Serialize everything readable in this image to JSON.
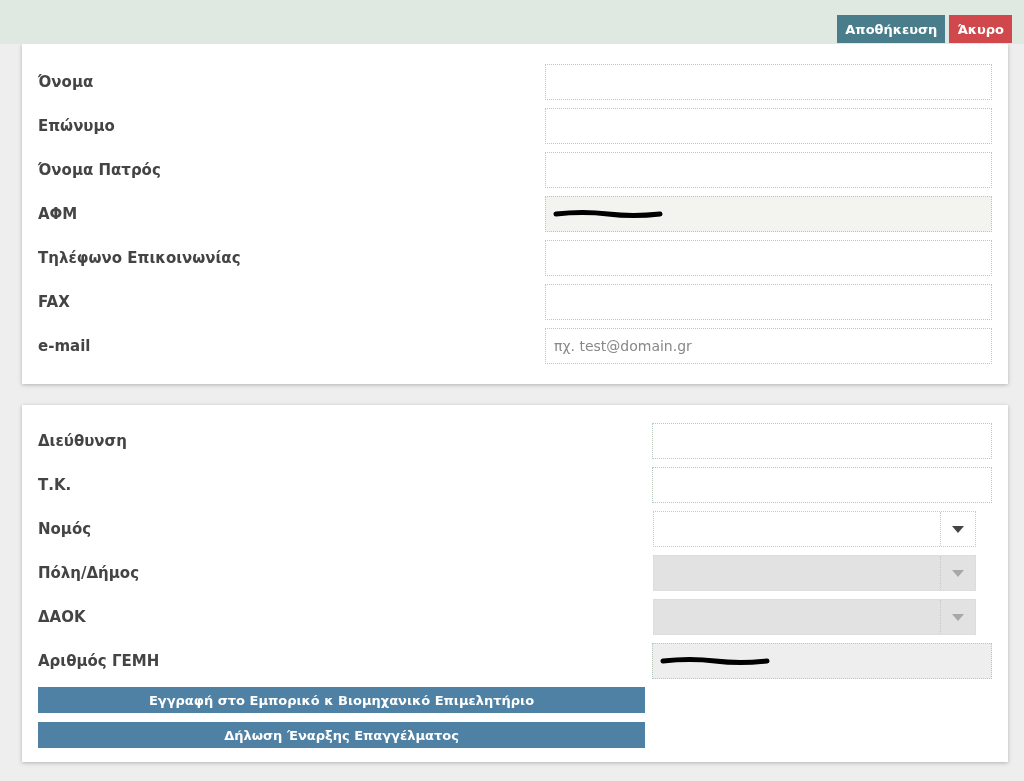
{
  "toolbar": {
    "buttons": [
      {
        "label": "Αποθήκευση",
        "kind": "save"
      },
      {
        "label": "Άκυρο",
        "kind": "cancel"
      }
    ]
  },
  "personal": {
    "fields": [
      {
        "label": "Όνομα",
        "kind": "text",
        "disabled": false,
        "redacted": false
      },
      {
        "label": "Επώνυμο",
        "kind": "text",
        "disabled": false,
        "redacted": false
      },
      {
        "label": "Όνομα Πατρός",
        "kind": "text",
        "disabled": false,
        "redacted": false
      },
      {
        "label": "ΑΦΜ",
        "kind": "text",
        "disabled": true,
        "redacted": true
      },
      {
        "label": "Τηλέφωνο Επικοινωνίας",
        "kind": "text",
        "disabled": false,
        "redacted": false
      },
      {
        "label": "FAX",
        "kind": "text",
        "disabled": false,
        "redacted": false
      },
      {
        "label": "e-mail",
        "kind": "text",
        "disabled": false,
        "redacted": false,
        "placeholder": "πχ. test@domain.gr"
      }
    ]
  },
  "address": {
    "fields": [
      {
        "label": "Διεύθυνση",
        "kind": "text",
        "disabled": false,
        "redacted": false
      },
      {
        "label": "Τ.Κ.",
        "kind": "text",
        "disabled": false,
        "redacted": false
      },
      {
        "label": "Νομός",
        "kind": "select",
        "disabled": false,
        "redacted": false
      },
      {
        "label": "Πόλη/Δήμος",
        "kind": "select",
        "disabled": true,
        "redacted": false
      },
      {
        "label": "ΔΑΟΚ",
        "kind": "select",
        "disabled": true,
        "redacted": false
      },
      {
        "label": "Αριθμός ΓΕΜΗ",
        "kind": "text",
        "disabled": true,
        "redacted": true
      }
    ],
    "buttons": [
      {
        "label": "Εγγραφή στο Εμπορικό κ Βιομηχανικό Επιμελητήριο"
      },
      {
        "label": "Δήλωση Έναρξης Επαγγέλματος"
      }
    ]
  }
}
